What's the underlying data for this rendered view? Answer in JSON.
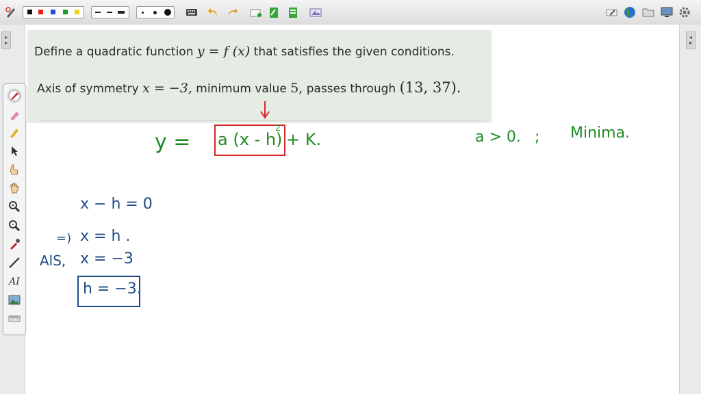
{
  "toolbar": {
    "colors": [
      "#111111",
      "#e02020",
      "#1f4fd0",
      "#1f9a2f",
      "#f2d21b"
    ],
    "icons": [
      "pen-settings-icon",
      "keyboard-icon",
      "undo-icon",
      "redo-icon",
      "new-page-icon",
      "page-icon",
      "page-list-icon",
      "screen-capture-icon",
      "eraser-icon",
      "globe-icon",
      "folder-icon",
      "display-icon",
      "settings-icon"
    ]
  },
  "question": {
    "line1_prefix": "Define a quadratic function",
    "line1_math": "y = f (x)",
    "line1_suffix": "that satisfies the given conditions.",
    "line2_prefix": "Axis of symmetry",
    "line2_math": "x = −3,",
    "line2_middle": "minimum value",
    "line2_value": "5,",
    "line2_suffix": "passes through",
    "line2_point": "(13, 37)."
  },
  "handwriting": {
    "formula_lhs": "y =",
    "formula_boxed": "a (x - h)",
    "formula_exponent": "2",
    "formula_rest": "+ K.",
    "condition": "a > 0.",
    "separator": ";",
    "condition_note": "Minima.",
    "step1": "x − h = 0",
    "step2_prefix": "=)",
    "step2": "x = h .",
    "step3_prefix": "AlS,",
    "step3": "x = −3",
    "result": "h = −3."
  },
  "tools": [
    "pen-icon",
    "highlighter-eraser-icon",
    "highlighter-icon",
    "pointer-icon",
    "hand-pointer-icon",
    "hand-icon",
    "zoom-in-icon",
    "zoom-out-icon",
    "eyedropper-icon",
    "line-icon",
    "text-icon",
    "image-icon",
    "ruler-icon"
  ],
  "accent_colors": {
    "annotation_green": "#1f8a22",
    "annotation_blue": "#1e4b86",
    "annotation_red": "#d62828"
  }
}
